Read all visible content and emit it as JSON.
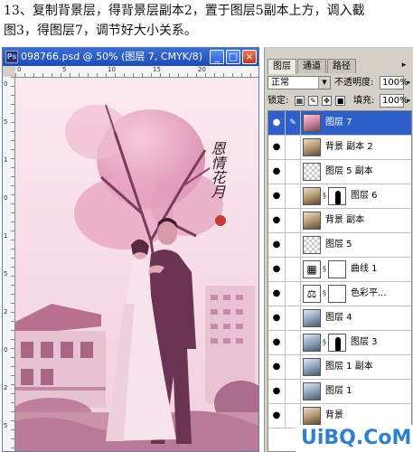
{
  "instruction": {
    "line1": "13、复制背景层，得背景层副本2，置于图层5副本上方，调入截",
    "line2": "图3，得图层7，调节好大小关系。"
  },
  "document": {
    "title": "098766.psd @ 50% (图层 7, CMYK/8)",
    "app_icon": "Ps",
    "ruler_top": [
      "0",
      "5",
      "10",
      "15",
      "20"
    ],
    "ruler_left": [
      "0",
      "5",
      "1",
      "0",
      "1",
      "5",
      "2",
      "0",
      "2",
      "5"
    ],
    "calligraphy": "恩情花月",
    "minimize_icon": "minimize-icon",
    "maximize_icon": "maximize-icon",
    "close_icon": "close-icon"
  },
  "panel": {
    "tabs": [
      "图层",
      "通道",
      "路径"
    ],
    "blend_mode": "正常",
    "opacity_label": "不透明度:",
    "opacity_value": "100%",
    "lock_label": "锁定:",
    "fill_label": "填充:",
    "fill_value": "100%",
    "menu_icon": "panel-menu-icon",
    "layers": [
      {
        "name": "图层 7",
        "thumb": "photo",
        "mask": false,
        "selected": true,
        "brush": true
      },
      {
        "name": "背景 副本 2",
        "thumb": "photo3",
        "mask": false,
        "selected": false,
        "brush": false
      },
      {
        "name": "图层 5 副本",
        "thumb": "check",
        "mask": false,
        "selected": false,
        "brush": false
      },
      {
        "name": "图层 6",
        "thumb": "photo3",
        "mask": true,
        "selected": false,
        "brush": false
      },
      {
        "name": "背景 副本",
        "thumb": "photo3",
        "mask": false,
        "selected": false,
        "brush": false
      },
      {
        "name": "图层 5",
        "thumb": "check",
        "mask": false,
        "selected": false,
        "brush": false
      },
      {
        "name": "曲线 1",
        "thumb": "adj",
        "adj_glyph": "▦",
        "mask": true,
        "selected": false,
        "brush": false,
        "mask_plain": true
      },
      {
        "name": "色彩平...",
        "thumb": "adj",
        "adj_glyph": "⚖",
        "mask": true,
        "selected": false,
        "brush": false,
        "mask_plain": true
      },
      {
        "name": "图层 4",
        "thumb": "photo2",
        "mask": false,
        "selected": false,
        "brush": false
      },
      {
        "name": "图层 3",
        "thumb": "photo2",
        "mask": true,
        "selected": false,
        "brush": false
      },
      {
        "name": "图层 1 副本",
        "thumb": "photo2",
        "mask": false,
        "selected": false,
        "brush": false
      },
      {
        "name": "图层 1",
        "thumb": "photo2",
        "mask": false,
        "selected": false,
        "brush": false
      },
      {
        "name": "背景",
        "thumb": "photo3",
        "mask": false,
        "selected": false,
        "brush": false
      }
    ]
  },
  "watermark": "UiBQ.CoM"
}
